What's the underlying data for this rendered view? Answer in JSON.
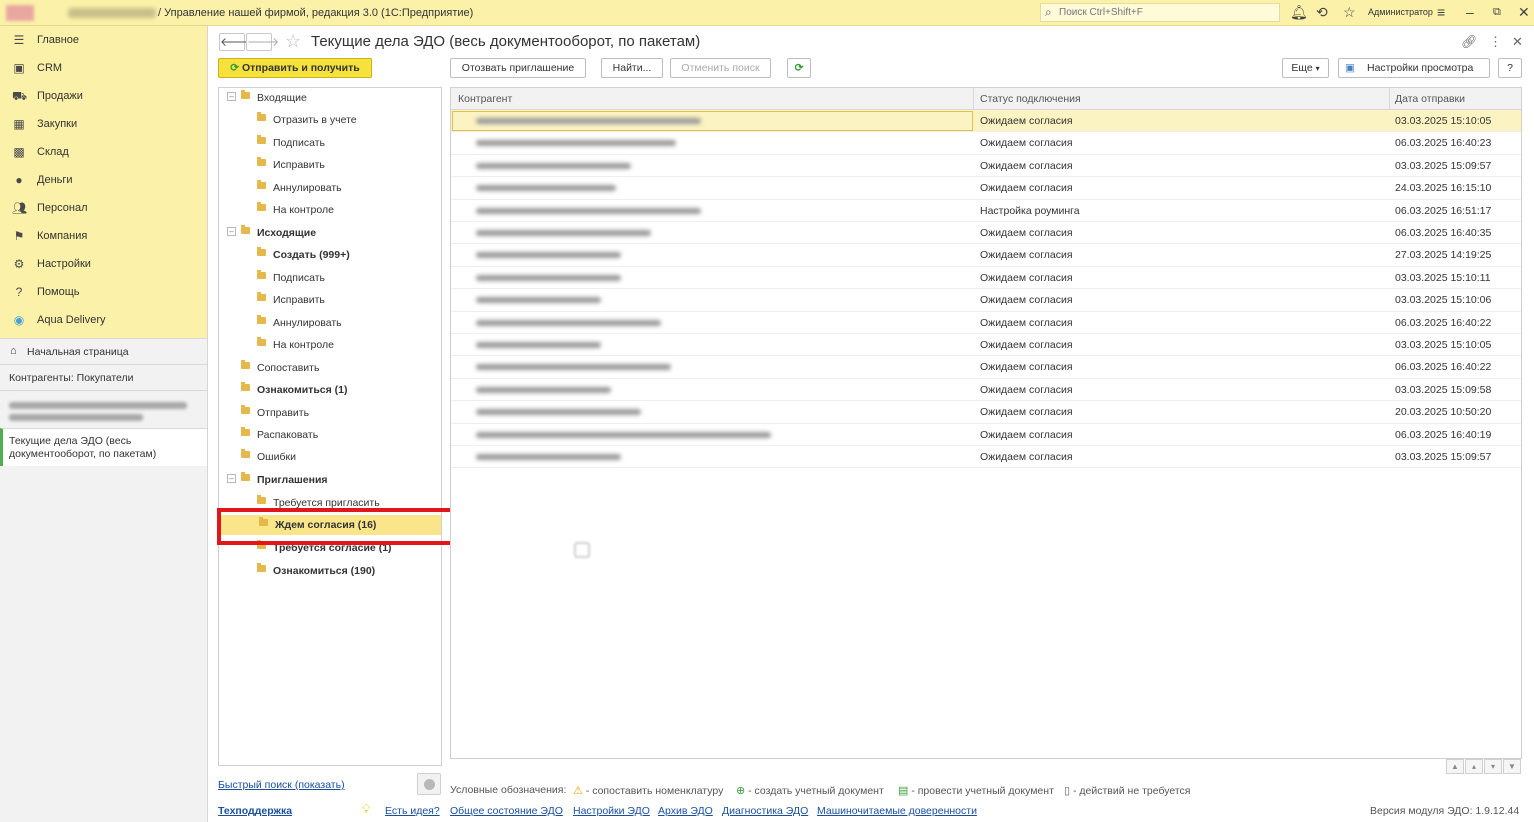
{
  "titlebar": {
    "title": "/ Управление нашей фирмой, редакция 3.0  (1С:Предприятие)",
    "search_placeholder": "Поиск Ctrl+Shift+F",
    "user": "Администратор"
  },
  "sidebar": {
    "sections": [
      {
        "label": "Главное",
        "icon": "menu-icon"
      },
      {
        "label": "CRM",
        "icon": "crm-icon"
      },
      {
        "label": "Продажи",
        "icon": "basket-icon"
      },
      {
        "label": "Закупки",
        "icon": "purchases-icon"
      },
      {
        "label": "Склад",
        "icon": "warehouse-icon"
      },
      {
        "label": "Деньги",
        "icon": "money-icon"
      },
      {
        "label": "Персонал",
        "icon": "people-icon"
      },
      {
        "label": "Компания",
        "icon": "flag-icon"
      },
      {
        "label": "Настройки",
        "icon": "gear-icon"
      },
      {
        "label": "Помощь",
        "icon": "help-icon"
      },
      {
        "label": "Aqua Delivery",
        "icon": "location-icon"
      }
    ],
    "open_windows": {
      "home": "Начальная страница",
      "counterparties": "Контрагенты: Покупатели",
      "current": "Текущие дела ЭДО (весь документооборот, по пакетам)"
    }
  },
  "form": {
    "title": "Текущие дела ЭДО (весь документооборот, по пакетам)",
    "buttons": {
      "send_receive": "Отправить и получить",
      "revoke_invitation": "Отозвать приглашение",
      "find": "Найти...",
      "cancel_search": "Отменить поиск",
      "more": "Еще",
      "view_settings": "Настройки просмотра",
      "help": "?"
    }
  },
  "tree": [
    {
      "label": "Входящие",
      "level": 0,
      "bold": false,
      "expandable": true
    },
    {
      "label": "Отразить в учете",
      "level": 1,
      "bold": false
    },
    {
      "label": "Подписать",
      "level": 1,
      "bold": false
    },
    {
      "label": "Исправить",
      "level": 1,
      "bold": false
    },
    {
      "label": "Аннулировать",
      "level": 1,
      "bold": false
    },
    {
      "label": "На контроле",
      "level": 1,
      "bold": false
    },
    {
      "label": "Исходящие",
      "level": 0,
      "bold": true,
      "expandable": true
    },
    {
      "label": "Создать (999+)",
      "level": 1,
      "bold": true
    },
    {
      "label": "Подписать",
      "level": 1,
      "bold": false
    },
    {
      "label": "Исправить",
      "level": 1,
      "bold": false
    },
    {
      "label": "Аннулировать",
      "level": 1,
      "bold": false
    },
    {
      "label": "На контроле",
      "level": 1,
      "bold": false
    },
    {
      "label": "Сопоставить",
      "level": 0,
      "bold": false
    },
    {
      "label": "Ознакомиться (1)",
      "level": 0,
      "bold": true
    },
    {
      "label": "Отправить",
      "level": 0,
      "bold": false
    },
    {
      "label": "Распаковать",
      "level": 0,
      "bold": false
    },
    {
      "label": "Ошибки",
      "level": 0,
      "bold": false
    },
    {
      "label": "Приглашения",
      "level": 0,
      "bold": true,
      "expandable": true
    },
    {
      "label": "Требуется пригласить",
      "level": 1,
      "bold": false
    },
    {
      "label": "Ждем согласия (16)",
      "level": 1,
      "bold": true,
      "selected": true
    },
    {
      "label": "Требуется согласие (1)",
      "level": 1,
      "bold": true
    },
    {
      "label": "Ознакомиться (190)",
      "level": 1,
      "bold": true
    }
  ],
  "table": {
    "columns": [
      "Контрагент",
      "Статус подключения",
      "Дата отправки"
    ],
    "rows": [
      {
        "status": "Ожидаем согласия",
        "date": "03.03.2025 15:10:05",
        "selected": true
      },
      {
        "status": "Ожидаем согласия",
        "date": "06.03.2025 16:40:23"
      },
      {
        "status": "Ожидаем согласия",
        "date": "03.03.2025 15:09:57"
      },
      {
        "status": "Ожидаем согласия",
        "date": "24.03.2025 16:15:10"
      },
      {
        "status": "Настройка роуминга",
        "date": "06.03.2025 16:51:17"
      },
      {
        "status": "Ожидаем согласия",
        "date": "06.03.2025 16:40:35"
      },
      {
        "status": "Ожидаем согласия",
        "date": "27.03.2025 14:19:25"
      },
      {
        "status": "Ожидаем согласия",
        "date": "03.03.2025 15:10:11"
      },
      {
        "status": "Ожидаем согласия",
        "date": "03.03.2025 15:10:06"
      },
      {
        "status": "Ожидаем согласия",
        "date": "06.03.2025 16:40:22"
      },
      {
        "status": "Ожидаем согласия",
        "date": "03.03.2025 15:10:05"
      },
      {
        "status": "Ожидаем согласия",
        "date": "06.03.2025 16:40:22"
      },
      {
        "status": "Ожидаем согласия",
        "date": "03.03.2025 15:09:58"
      },
      {
        "status": "Ожидаем согласия",
        "date": "20.03.2025 10:50:20"
      },
      {
        "status": "Ожидаем согласия",
        "date": "06.03.2025 16:40:19"
      },
      {
        "status": "Ожидаем согласия",
        "date": "03.03.2025 15:09:57"
      }
    ]
  },
  "footer": {
    "quick_search": "Быстрый поиск (показать)",
    "support": "Техподдержка",
    "idea": "Есть идея?",
    "edo_state": "Общее состояние ЭДО",
    "edo_settings": "Настройки ЭДО",
    "edo_archive": "Архив ЭДО",
    "edo_diagnostics": "Диагностика ЭДО",
    "poa": "Машиночитаемые доверенности",
    "legend_title": "Условные обозначения:",
    "legend_match": "- сопоставить номенклатуру",
    "legend_create": "- создать учетный документ",
    "legend_post": "- провести учетный документ",
    "legend_none": "- действий не требуется",
    "version": "Версия модуля ЭДО: 1.9.12.44"
  }
}
